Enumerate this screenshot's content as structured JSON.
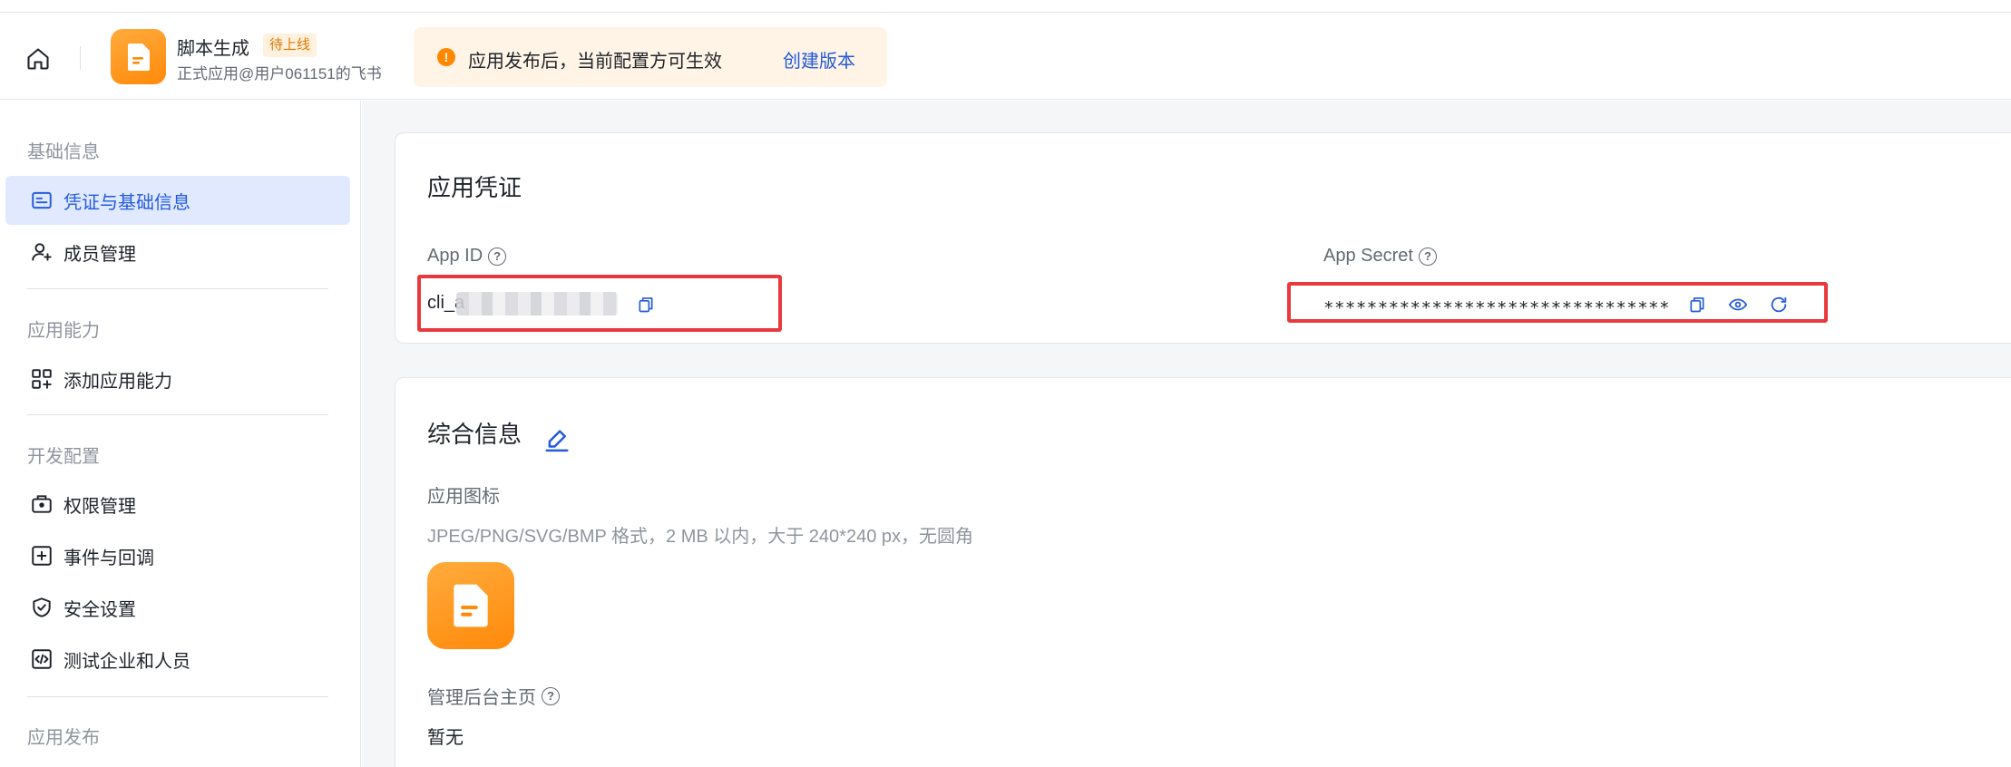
{
  "header": {
    "app_name": "脚本生成",
    "app_status_badge": "待上线",
    "app_subtitle": "正式应用@用户061151的飞书",
    "notice": {
      "icon": "warning-icon",
      "icon_glyph": "!",
      "text": "应用发布后，当前配置方可生效",
      "link": "创建版本",
      "color": "#ff8800"
    }
  },
  "sidebar": {
    "sections": [
      {
        "title": "基础信息",
        "items": [
          {
            "label": "凭证与基础信息",
            "icon": "id-card-icon",
            "active": true
          },
          {
            "label": "成员管理",
            "icon": "user-add-icon",
            "active": false
          }
        ]
      },
      {
        "title": "应用能力",
        "items": [
          {
            "label": "添加应用能力",
            "icon": "apps-add-icon",
            "active": false
          }
        ]
      },
      {
        "title": "开发配置",
        "items": [
          {
            "label": "权限管理",
            "icon": "briefcase-lock-icon",
            "active": false
          },
          {
            "label": "事件与回调",
            "icon": "event-add-icon",
            "active": false
          },
          {
            "label": "安全设置",
            "icon": "shield-check-icon",
            "active": false
          },
          {
            "label": "测试企业和人员",
            "icon": "code-icon",
            "active": false
          }
        ]
      },
      {
        "title": "应用发布",
        "items": []
      }
    ]
  },
  "credentials": {
    "title": "应用凭证",
    "app_id_label": "App ID",
    "app_id_value": "cli_a",
    "app_secret_label": "App Secret",
    "app_secret_value": "********************************"
  },
  "general": {
    "title": "综合信息",
    "icon_label": "应用图标",
    "icon_hint": "JPEG/PNG/SVG/BMP 格式，2 MB 以内，大于 240*240 px，无圆角",
    "homepage_label": "管理后台主页",
    "homepage_value": "暂无"
  },
  "colors": {
    "accent": "#245bdb",
    "active_bg": "#e0e9ff",
    "brand_orange": "#ff8a0a",
    "highlight_red": "#e8393f"
  }
}
